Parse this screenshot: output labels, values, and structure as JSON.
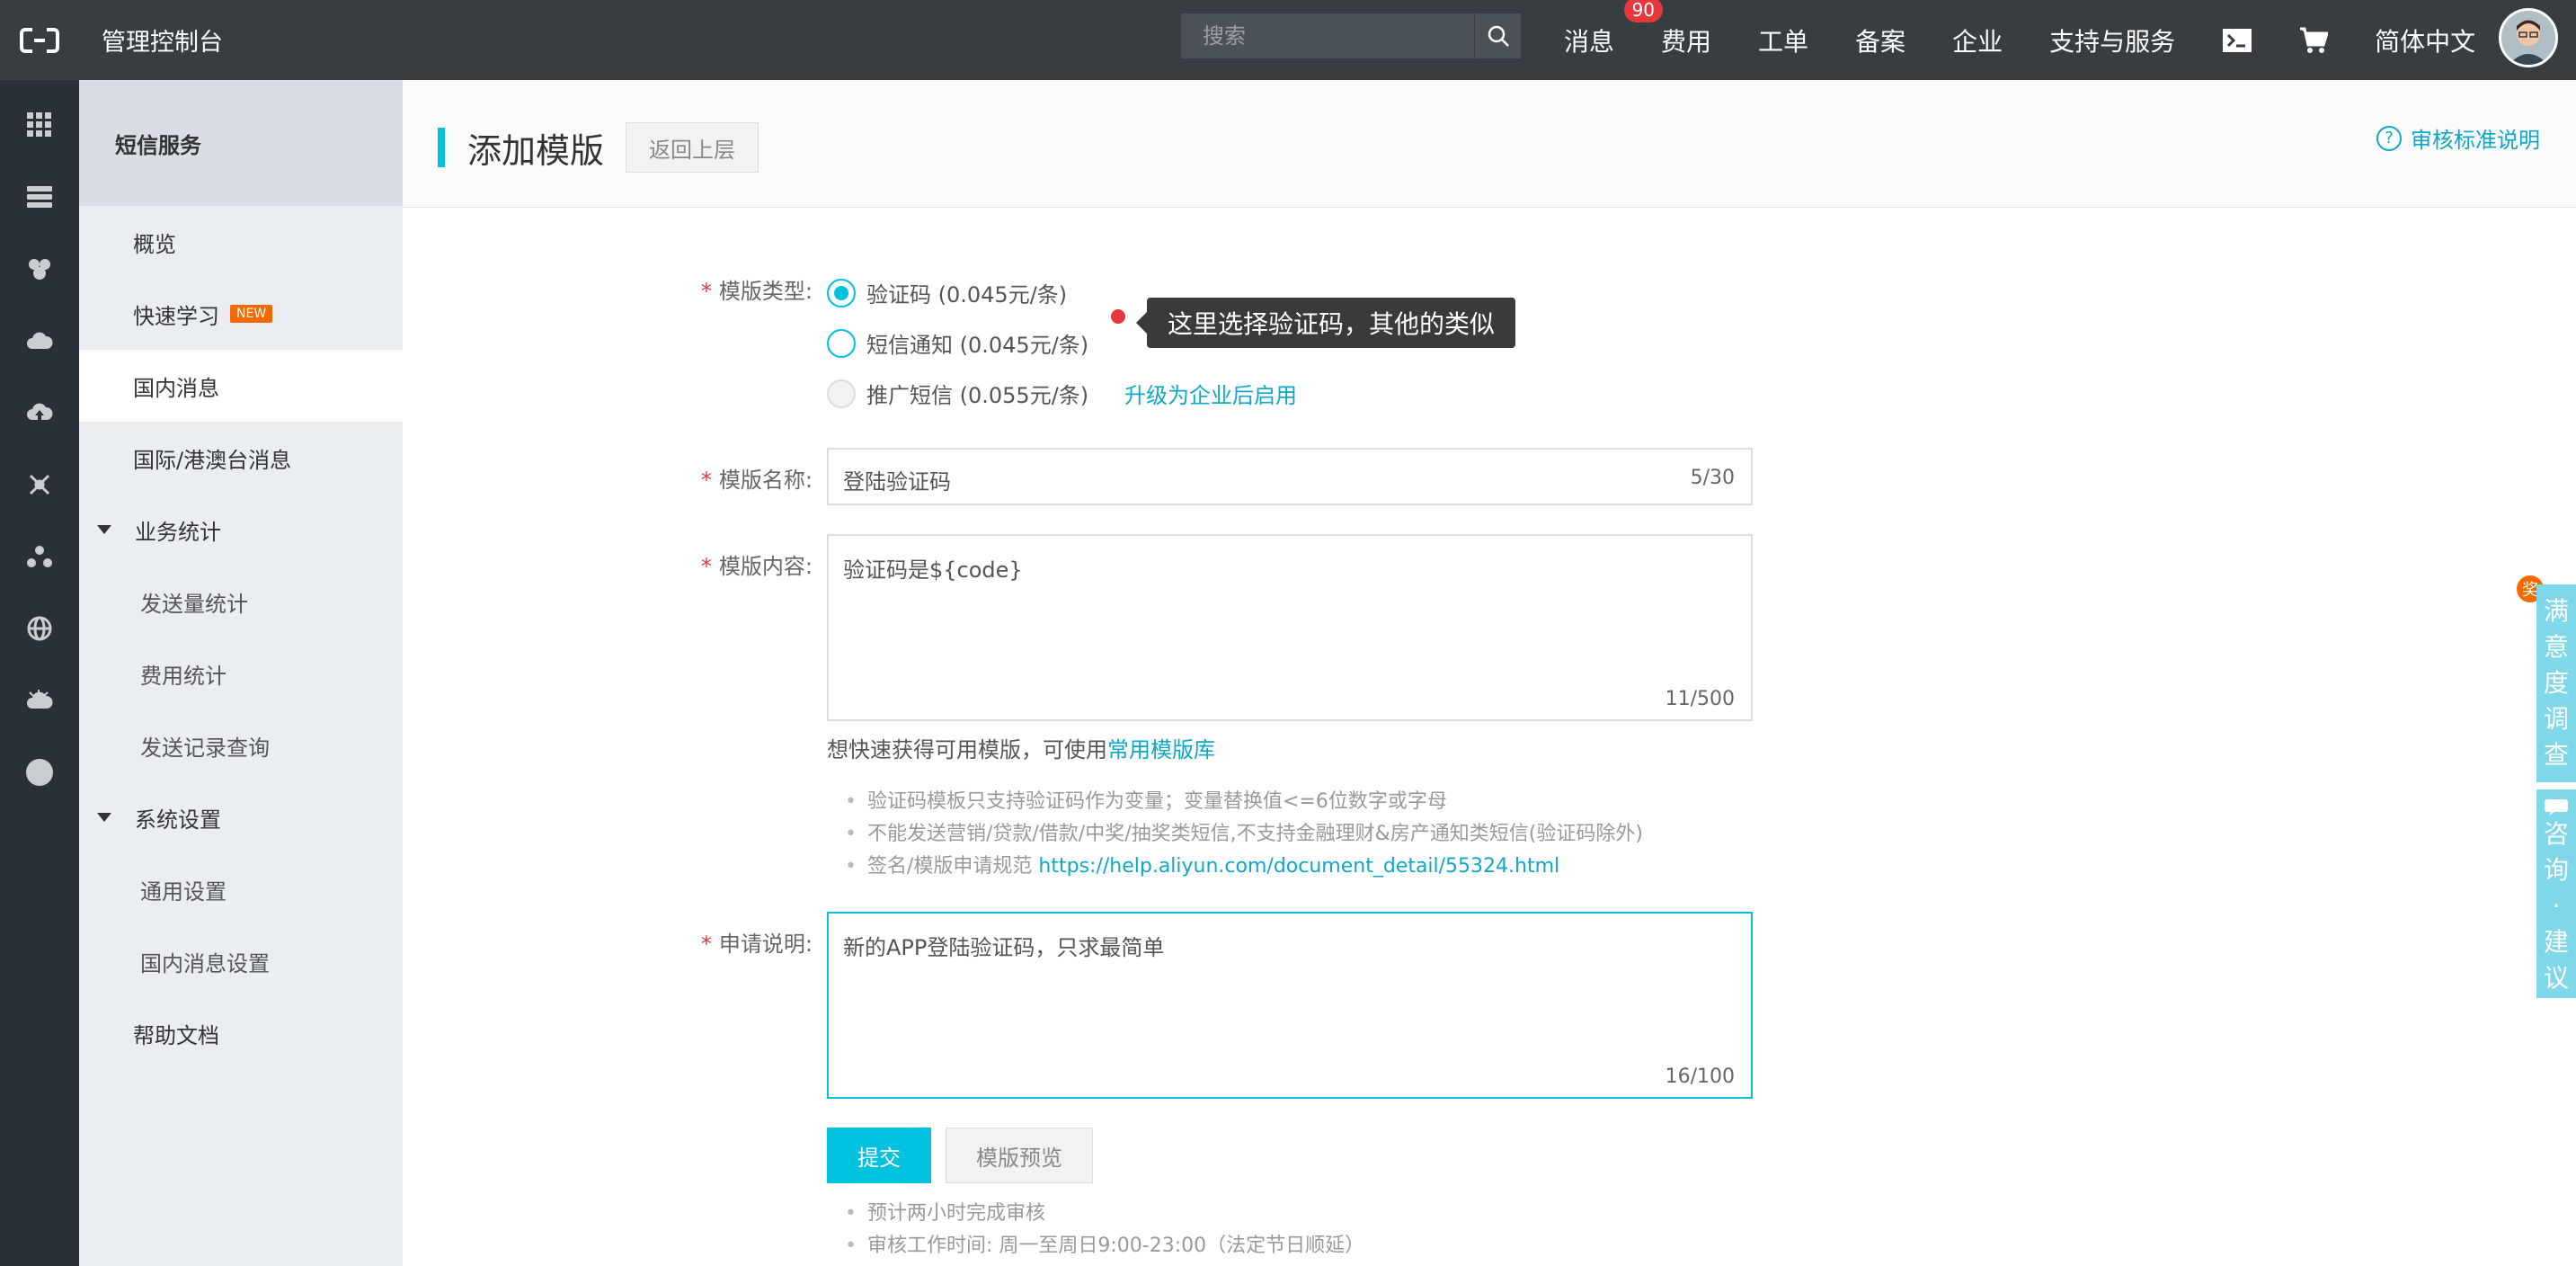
{
  "topbar": {
    "title": "管理控制台",
    "search_placeholder": "搜索",
    "nav": {
      "messages": "消息",
      "messages_badge": "90",
      "billing": "费用",
      "tickets": "工单",
      "icp": "备案",
      "enterprise": "企业",
      "support": "支持与服务",
      "language": "简体中文"
    }
  },
  "sidebar": {
    "header": "短信服务",
    "items": {
      "overview": "概览",
      "quick_learn": "快速学习",
      "quick_learn_tag": "NEW",
      "domestic": "国内消息",
      "international": "国际/港澳台消息",
      "stats_group": "业务统计",
      "send_stats": "发送量统计",
      "cost_stats": "费用统计",
      "send_records": "发送记录查询",
      "settings_group": "系统设置",
      "general_settings": "通用设置",
      "domestic_settings": "国内消息设置",
      "help_docs": "帮助文档"
    }
  },
  "page": {
    "title": "添加模版",
    "back_label": "返回上层",
    "help_label": "审核标准说明",
    "help_icon": "?"
  },
  "form": {
    "type_label": "模版类型:",
    "type_options": {
      "verify": "验证码 (0.045元/条)",
      "notify": "短信通知 (0.045元/条)",
      "promo": "推广短信 (0.055元/条)"
    },
    "upgrade_link": "升级为企业后启用",
    "tooltip": "这里选择验证码，其他的类似",
    "name_label": "模版名称:",
    "name_value": "登陆验证码",
    "name_counter": "5/30",
    "content_label": "模版内容:",
    "content_value": "验证码是${code}",
    "content_counter": "11/500",
    "hint_prefix": "想快速获得可用模版，可使用",
    "hint_link": "常用模版库",
    "rules": {
      "rule1": "验证码模板只支持验证码作为变量；变量替换值<=6位数字或字母",
      "rule2": "不能发送营销/贷款/借款/中奖/抽奖类短信,不支持金融理财&房产通知类短信(验证码除外)",
      "rule3_prefix": "签名/模版申请规范",
      "rule3_link": "https://help.aliyun.com/document_detail/55324.html"
    },
    "remark_label": "申请说明:",
    "remark_value": "新的APP登陆验证码，只求最简单",
    "remark_counter": "16/100",
    "submit_label": "提交",
    "preview_label": "模版预览",
    "notes": {
      "note1": "预计两小时完成审核",
      "note2": "审核工作时间: 周一至周日9:00-23:00（法定节日顺延）"
    }
  },
  "float_tabs": {
    "prize": "奖",
    "survey": [
      "满",
      "意",
      "度",
      "调",
      "查"
    ],
    "consult": [
      "咨",
      "询",
      "·",
      "建",
      "议"
    ]
  },
  "colors": {
    "topbar": "#373d41",
    "rail": "#293038",
    "accent": "#00c1de",
    "link": "#0ea8c7",
    "badge": "#e4393c"
  }
}
